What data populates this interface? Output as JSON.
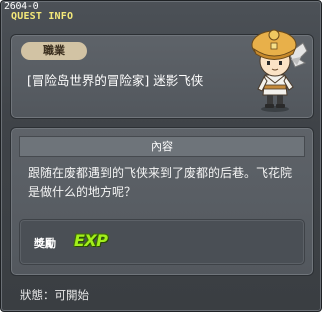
{
  "window": {
    "quest_id": "2604-0",
    "title": "QUEST INFO"
  },
  "job": {
    "tag_label": "職業",
    "name": "[冒险岛世界的冒险家] 迷影飞侠"
  },
  "content": {
    "header": "內容",
    "text": "跟随在废都遇到的飞侠来到了废都的后巷。飞花院是做什么的地方呢？"
  },
  "reward": {
    "label": "獎勵",
    "exp_text": "EXP"
  },
  "status": {
    "label": "狀態：",
    "value": "可開始"
  },
  "colors": {
    "title_yellow": "#f4e97a",
    "exp_green": "#a2f01a",
    "job_tag_bg": "#d2c3a4"
  },
  "icons": {
    "npc": "npc-thief-portrait-icon",
    "exp": "exp-icon"
  }
}
